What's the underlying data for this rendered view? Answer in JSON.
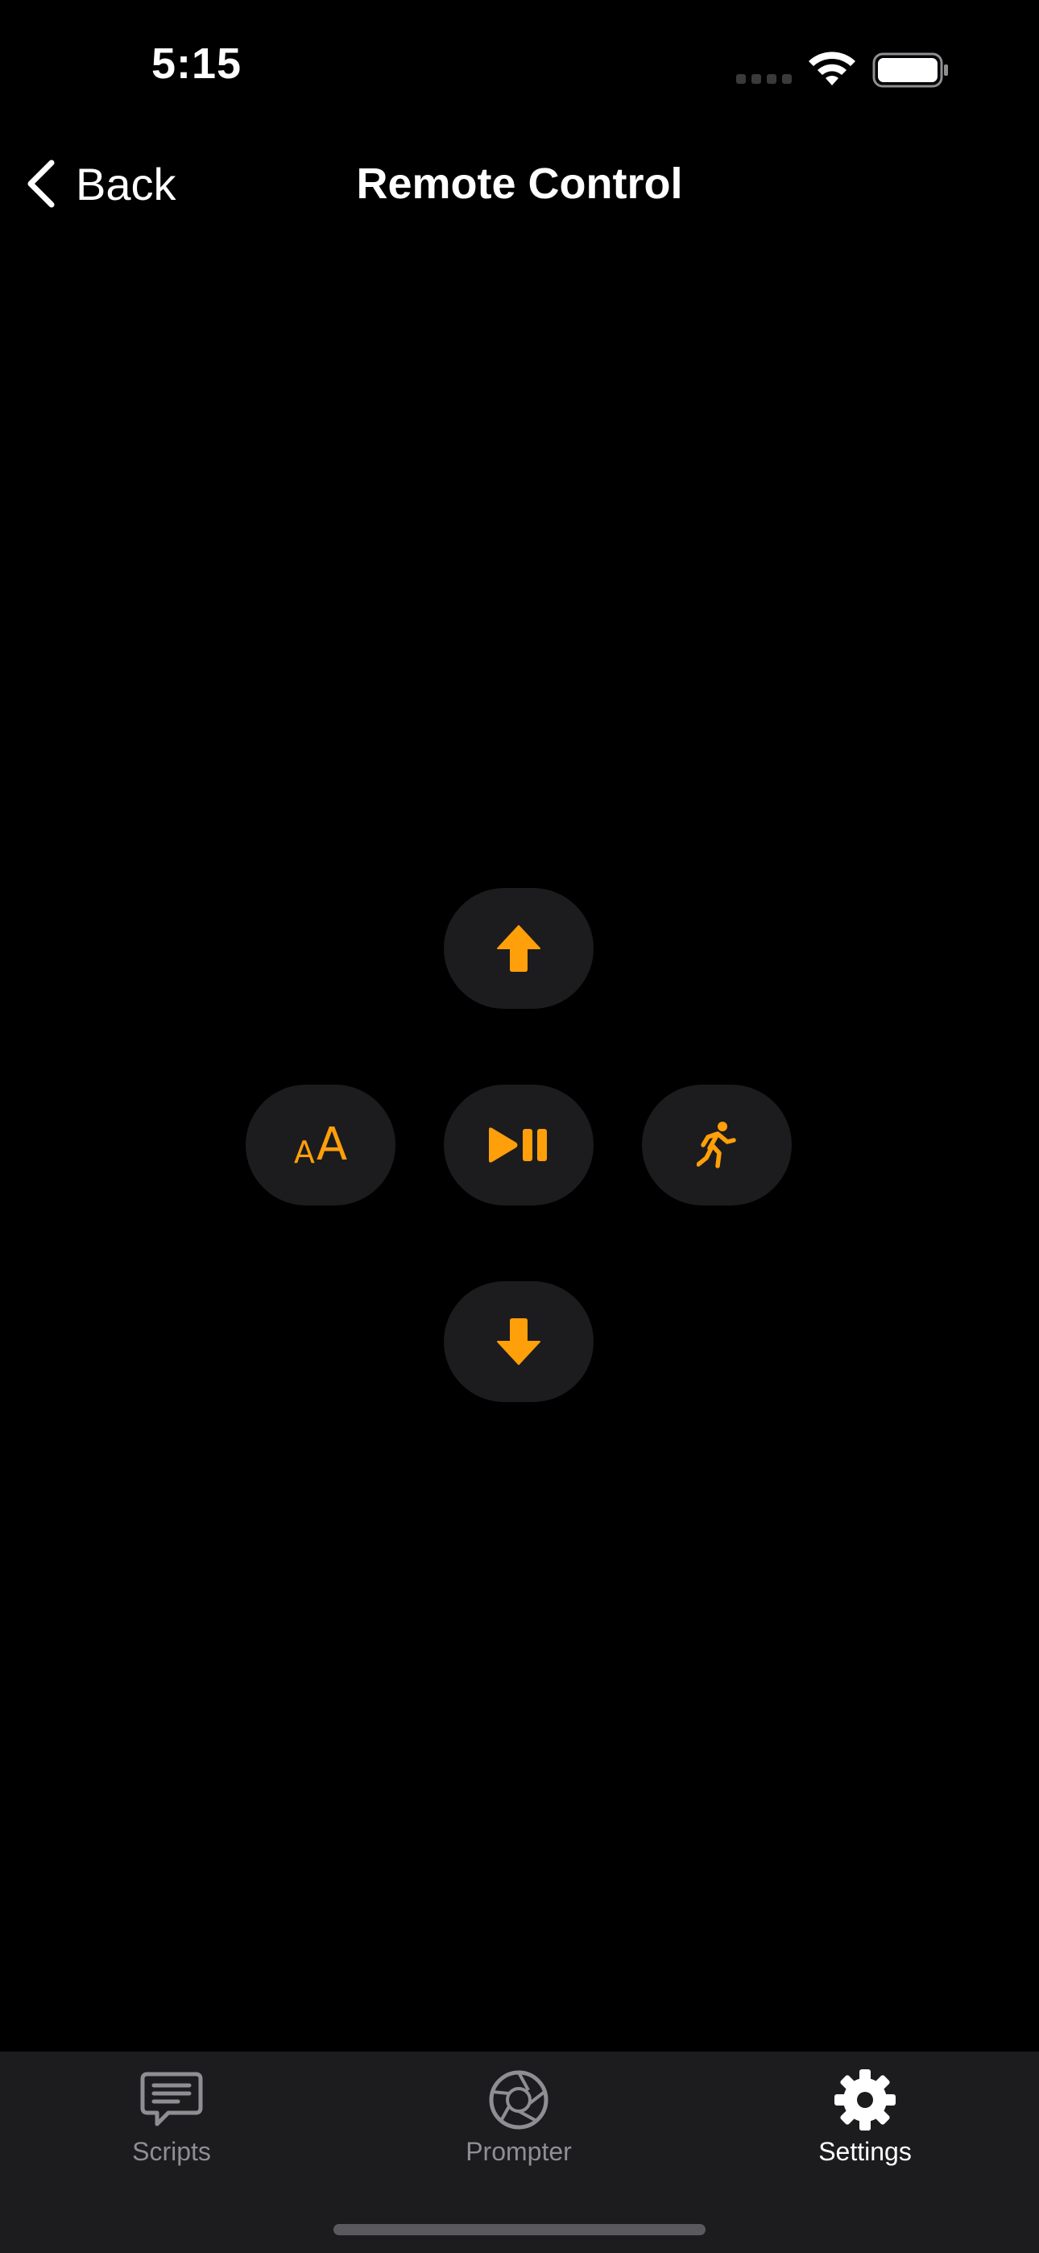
{
  "status_bar": {
    "time": "5:15"
  },
  "nav": {
    "back_label": "Back",
    "title": "Remote Control"
  },
  "remote": {
    "accent_color": "#ff9f0a",
    "button_bg": "#1c1c1e",
    "font_glyph_small": "A",
    "font_glyph_big": "A",
    "buttons": [
      {
        "id": "scroll-up",
        "icon": "arrow-up-icon"
      },
      {
        "id": "font-size",
        "icon": "text-size-icon"
      },
      {
        "id": "play-pause",
        "icon": "play-pause-icon"
      },
      {
        "id": "speed",
        "icon": "running-figure-icon"
      },
      {
        "id": "scroll-down",
        "icon": "arrow-down-icon"
      }
    ]
  },
  "tab_bar": {
    "items": [
      {
        "label": "Scripts",
        "icon": "speech-bubble-icon",
        "selected": false
      },
      {
        "label": "Prompter",
        "icon": "camera-aperture-icon",
        "selected": false
      },
      {
        "label": "Settings",
        "icon": "gear-icon",
        "selected": true
      }
    ]
  }
}
